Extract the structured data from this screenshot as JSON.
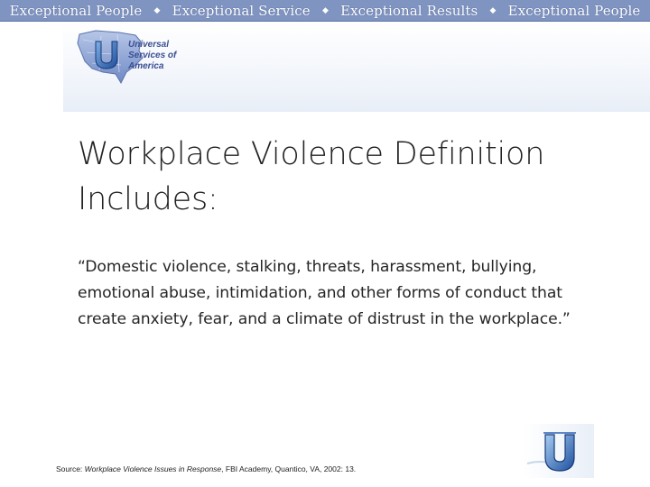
{
  "banner": {
    "items": [
      "Exceptional People",
      "Exceptional Service",
      "Exceptional Results",
      "Exceptional People"
    ]
  },
  "logo": {
    "lines": [
      "Universal",
      "Services of",
      "America"
    ],
    "icon": "usa-map-u-logo-icon",
    "colors": {
      "map": "#8fa7d6",
      "accent": "#3a4e93"
    }
  },
  "slide": {
    "title_line1": "Workplace Violence Definition",
    "title_line2": "Includes:",
    "body": "“Domestic violence, stalking, threats, harassment, bullying, emotional abuse, intimidation, and other forms of conduct that create anxiety, fear, and a climate of distrust in the workplace.”"
  },
  "footer": {
    "source_prefix": "Source: ",
    "source_title": "Workplace Violence Issues in Response",
    "source_rest": ", FBI Academy, Quantico, VA, 2002: 13."
  },
  "corner_logo": {
    "icon": "u-logo-icon"
  }
}
